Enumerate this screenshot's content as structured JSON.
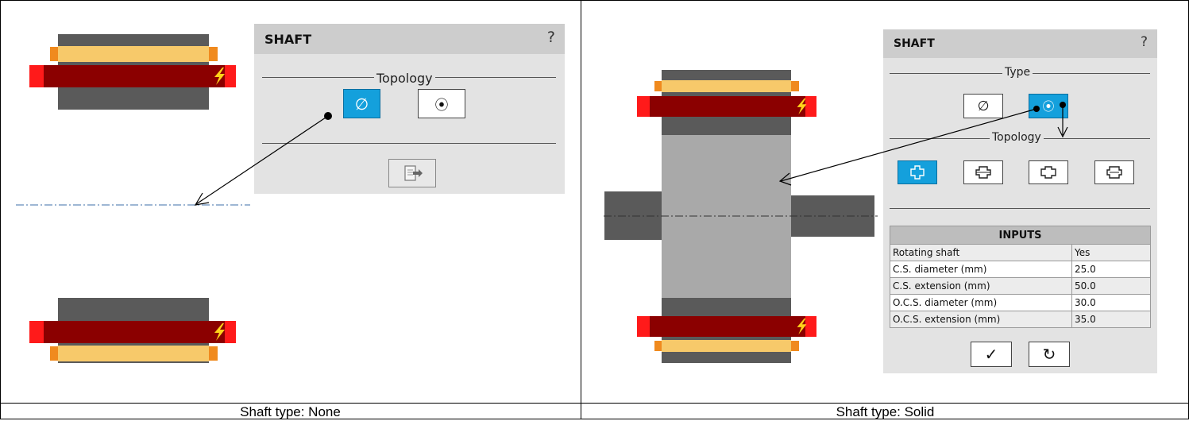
{
  "left": {
    "panel": {
      "title": "SHAFT",
      "help": "?",
      "section": "Topology",
      "export_icon": "export-icon"
    },
    "topology_buttons": [
      {
        "icon": "empty-set-icon",
        "glyph": "∅",
        "selected": true
      },
      {
        "icon": "circle-dot-icon",
        "glyph": "⦿",
        "selected": false
      }
    ],
    "caption": "Shaft type: None"
  },
  "right": {
    "panel": {
      "title": "SHAFT",
      "help": "?",
      "type_section": "Type",
      "topology_section": "Topology"
    },
    "type_buttons": [
      {
        "icon": "empty-set-icon",
        "glyph": "∅",
        "selected": false
      },
      {
        "icon": "circle-dot-icon",
        "glyph": "⦿",
        "selected": true
      }
    ],
    "topology_buttons": [
      {
        "icon": "shaft-topology-1-icon",
        "selected": true
      },
      {
        "icon": "shaft-topology-2-icon",
        "selected": false
      },
      {
        "icon": "shaft-topology-3-icon",
        "selected": false
      },
      {
        "icon": "shaft-topology-4-icon",
        "selected": false
      }
    ],
    "inputs": {
      "title": "INPUTS",
      "rows": [
        {
          "label": "Rotating shaft",
          "value": "Yes"
        },
        {
          "label": "C.S. diameter (mm)",
          "value": "25.0"
        },
        {
          "label": "C.S. extension (mm)",
          "value": "50.0"
        },
        {
          "label": "O.C.S. diameter (mm)",
          "value": "30.0"
        },
        {
          "label": "O.C.S. extension (mm)",
          "value": "35.0"
        }
      ]
    },
    "actions": [
      {
        "icon": "check-icon",
        "glyph": "✓"
      },
      {
        "icon": "reset-icon",
        "glyph": "↻"
      }
    ],
    "caption": "Shaft type: Solid"
  },
  "colors": {
    "magnet": "#8b0000",
    "magnet_end": "#ff1a1a",
    "winding": "#f7c96a",
    "winding_end": "#f08a1e",
    "core": "#5a5a5a",
    "shaft": "#a9a9a9",
    "selected": "#14a0dc"
  }
}
